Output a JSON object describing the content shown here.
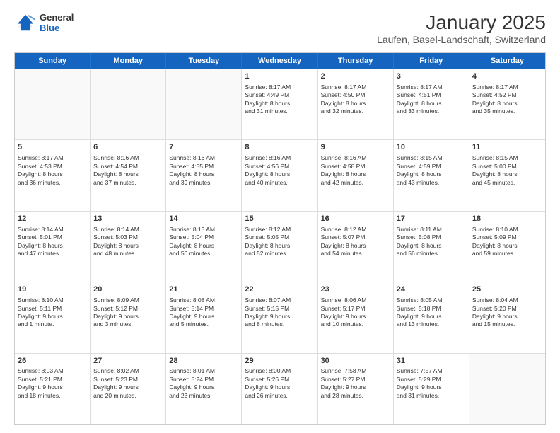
{
  "logo": {
    "general": "General",
    "blue": "Blue"
  },
  "title": "January 2025",
  "subtitle": "Laufen, Basel-Landschaft, Switzerland",
  "days": [
    "Sunday",
    "Monday",
    "Tuesday",
    "Wednesday",
    "Thursday",
    "Friday",
    "Saturday"
  ],
  "weeks": [
    [
      {
        "day": "",
        "info": ""
      },
      {
        "day": "",
        "info": ""
      },
      {
        "day": "",
        "info": ""
      },
      {
        "day": "1",
        "info": "Sunrise: 8:17 AM\nSunset: 4:49 PM\nDaylight: 8 hours\nand 31 minutes."
      },
      {
        "day": "2",
        "info": "Sunrise: 8:17 AM\nSunset: 4:50 PM\nDaylight: 8 hours\nand 32 minutes."
      },
      {
        "day": "3",
        "info": "Sunrise: 8:17 AM\nSunset: 4:51 PM\nDaylight: 8 hours\nand 33 minutes."
      },
      {
        "day": "4",
        "info": "Sunrise: 8:17 AM\nSunset: 4:52 PM\nDaylight: 8 hours\nand 35 minutes."
      }
    ],
    [
      {
        "day": "5",
        "info": "Sunrise: 8:17 AM\nSunset: 4:53 PM\nDaylight: 8 hours\nand 36 minutes."
      },
      {
        "day": "6",
        "info": "Sunrise: 8:16 AM\nSunset: 4:54 PM\nDaylight: 8 hours\nand 37 minutes."
      },
      {
        "day": "7",
        "info": "Sunrise: 8:16 AM\nSunset: 4:55 PM\nDaylight: 8 hours\nand 39 minutes."
      },
      {
        "day": "8",
        "info": "Sunrise: 8:16 AM\nSunset: 4:56 PM\nDaylight: 8 hours\nand 40 minutes."
      },
      {
        "day": "9",
        "info": "Sunrise: 8:16 AM\nSunset: 4:58 PM\nDaylight: 8 hours\nand 42 minutes."
      },
      {
        "day": "10",
        "info": "Sunrise: 8:15 AM\nSunset: 4:59 PM\nDaylight: 8 hours\nand 43 minutes."
      },
      {
        "day": "11",
        "info": "Sunrise: 8:15 AM\nSunset: 5:00 PM\nDaylight: 8 hours\nand 45 minutes."
      }
    ],
    [
      {
        "day": "12",
        "info": "Sunrise: 8:14 AM\nSunset: 5:01 PM\nDaylight: 8 hours\nand 47 minutes."
      },
      {
        "day": "13",
        "info": "Sunrise: 8:14 AM\nSunset: 5:03 PM\nDaylight: 8 hours\nand 48 minutes."
      },
      {
        "day": "14",
        "info": "Sunrise: 8:13 AM\nSunset: 5:04 PM\nDaylight: 8 hours\nand 50 minutes."
      },
      {
        "day": "15",
        "info": "Sunrise: 8:12 AM\nSunset: 5:05 PM\nDaylight: 8 hours\nand 52 minutes."
      },
      {
        "day": "16",
        "info": "Sunrise: 8:12 AM\nSunset: 5:07 PM\nDaylight: 8 hours\nand 54 minutes."
      },
      {
        "day": "17",
        "info": "Sunrise: 8:11 AM\nSunset: 5:08 PM\nDaylight: 8 hours\nand 56 minutes."
      },
      {
        "day": "18",
        "info": "Sunrise: 8:10 AM\nSunset: 5:09 PM\nDaylight: 8 hours\nand 59 minutes."
      }
    ],
    [
      {
        "day": "19",
        "info": "Sunrise: 8:10 AM\nSunset: 5:11 PM\nDaylight: 9 hours\nand 1 minute."
      },
      {
        "day": "20",
        "info": "Sunrise: 8:09 AM\nSunset: 5:12 PM\nDaylight: 9 hours\nand 3 minutes."
      },
      {
        "day": "21",
        "info": "Sunrise: 8:08 AM\nSunset: 5:14 PM\nDaylight: 9 hours\nand 5 minutes."
      },
      {
        "day": "22",
        "info": "Sunrise: 8:07 AM\nSunset: 5:15 PM\nDaylight: 9 hours\nand 8 minutes."
      },
      {
        "day": "23",
        "info": "Sunrise: 8:06 AM\nSunset: 5:17 PM\nDaylight: 9 hours\nand 10 minutes."
      },
      {
        "day": "24",
        "info": "Sunrise: 8:05 AM\nSunset: 5:18 PM\nDaylight: 9 hours\nand 13 minutes."
      },
      {
        "day": "25",
        "info": "Sunrise: 8:04 AM\nSunset: 5:20 PM\nDaylight: 9 hours\nand 15 minutes."
      }
    ],
    [
      {
        "day": "26",
        "info": "Sunrise: 8:03 AM\nSunset: 5:21 PM\nDaylight: 9 hours\nand 18 minutes."
      },
      {
        "day": "27",
        "info": "Sunrise: 8:02 AM\nSunset: 5:23 PM\nDaylight: 9 hours\nand 20 minutes."
      },
      {
        "day": "28",
        "info": "Sunrise: 8:01 AM\nSunset: 5:24 PM\nDaylight: 9 hours\nand 23 minutes."
      },
      {
        "day": "29",
        "info": "Sunrise: 8:00 AM\nSunset: 5:26 PM\nDaylight: 9 hours\nand 26 minutes."
      },
      {
        "day": "30",
        "info": "Sunrise: 7:58 AM\nSunset: 5:27 PM\nDaylight: 9 hours\nand 28 minutes."
      },
      {
        "day": "31",
        "info": "Sunrise: 7:57 AM\nSunset: 5:29 PM\nDaylight: 9 hours\nand 31 minutes."
      },
      {
        "day": "",
        "info": ""
      }
    ]
  ]
}
